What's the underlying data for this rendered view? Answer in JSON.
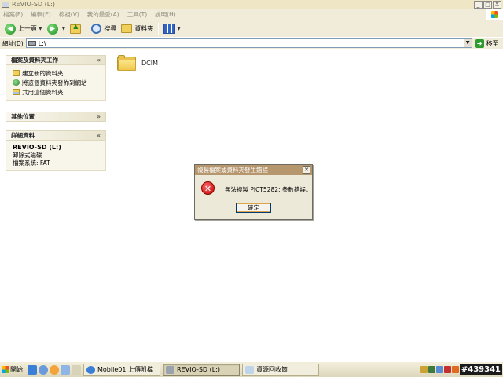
{
  "window": {
    "title": "REVIO-SD (L:)",
    "buttons": [
      "_",
      "□",
      "X"
    ]
  },
  "menu": [
    "檔案(F)",
    "編輯(E)",
    "檢視(V)",
    "我的最愛(A)",
    "工具(T)",
    "說明(H)"
  ],
  "toolbar": {
    "back_label": "上一頁",
    "search_label": "搜尋",
    "folders_label": "資料夾",
    "icons": [
      "back-icon",
      "forward-icon",
      "folder-up-icon",
      "search-icon",
      "folders-icon",
      "views-icon"
    ]
  },
  "address": {
    "label": "網址(D)",
    "value": "L:\\",
    "go_label": "移至"
  },
  "sidebar": {
    "tasks": {
      "title": "檔案及資料夾工作",
      "items": [
        {
          "label": "建立新的資料夾",
          "icon": "new-folder-icon"
        },
        {
          "label": "將這個資料夾發佈到網站",
          "icon": "publish-web-icon"
        },
        {
          "label": "共用這個資料夾",
          "icon": "share-folder-icon"
        }
      ]
    },
    "other": {
      "title": "其他位置"
    },
    "details": {
      "title": "詳細資料",
      "name": "REVIO-SD (L:)",
      "type": "卸除式磁碟",
      "filesystem": "檔案系統: FAT"
    }
  },
  "files": [
    {
      "name": "DCIM",
      "icon": "folder-icon"
    }
  ],
  "dialog": {
    "title": "複製檔案或資料夾發生錯誤",
    "message": "無法複製 PICT5282: 參數錯誤。",
    "ok_label": "確定",
    "icon": "error-icon"
  },
  "taskbar": {
    "start_label": "開始",
    "tasks": [
      {
        "label": "Mobile01 上傳附檔",
        "active": false
      },
      {
        "label": "REVIO-SD (L:)",
        "active": true
      },
      {
        "label": "資源回收筒",
        "active": false
      }
    ],
    "watermark": "#439341"
  }
}
